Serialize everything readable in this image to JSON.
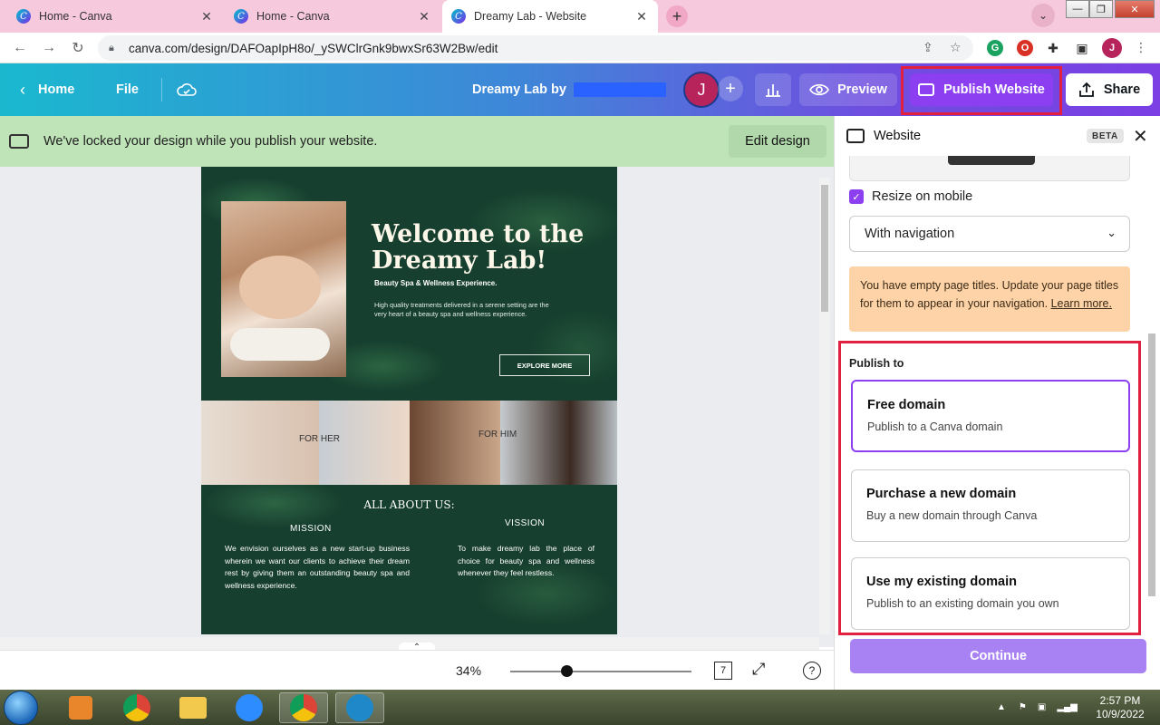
{
  "browser": {
    "tabs": [
      {
        "title": "Home - Canva",
        "active": false
      },
      {
        "title": "Home - Canva",
        "active": false
      },
      {
        "title": "Dreamy Lab - Website",
        "active": true
      }
    ],
    "url": "canva.com/design/DAFOapIpH8o/_ySWClrGnk9bwxSr63W2Bw/edit",
    "profile_initial": "J"
  },
  "topbar": {
    "home_label": "Home",
    "file_label": "File",
    "doc_title": "Dreamy Lab by",
    "avatar_initial": "J",
    "preview_label": "Preview",
    "publish_label": "Publish Website",
    "share_label": "Share"
  },
  "banner": {
    "message": "We've locked your design while you publish your website.",
    "edit_label": "Edit design"
  },
  "design": {
    "welcome": "Welcome to the Dreamy Lab!",
    "tagline": "Beauty Spa & Wellness Experience.",
    "intro": "High quality treatments delivered in a serene setting are the very heart of a beauty spa and wellness experience.",
    "cta": "EXPLORE MORE",
    "for_her": "FOR HER",
    "for_him": "FOR HIM",
    "about_title": "ALL ABOUT US:",
    "mission_heading": "MISSION",
    "mission_text": "We envision ourselves as a new start-up business wherein we want our clients to achieve their dream rest by giving them an outstanding beauty spa and wellness experience.",
    "vision_heading": "VISSION",
    "vision_text": "To make dreamy lab the place of choice for beauty spa and wellness whenever they feel restless."
  },
  "zoom": {
    "percent": "34%",
    "level": 0.34,
    "pages": "7"
  },
  "panel": {
    "title": "Website",
    "badge": "BETA",
    "resize_label": "Resize on mobile",
    "resize_checked": true,
    "nav_select": "With navigation",
    "warning_text": "You have empty page titles. Update your page titles for them to appear in your navigation.",
    "warning_link": "Learn more.",
    "publish_to_label": "Publish to",
    "options": [
      {
        "title": "Free domain",
        "desc": "Publish to a Canva domain",
        "selected": true
      },
      {
        "title": "Purchase a new domain",
        "desc": "Buy a new domain through Canva",
        "selected": false
      },
      {
        "title": "Use my existing domain",
        "desc": "Publish to an existing domain you own",
        "selected": false
      }
    ],
    "continue_label": "Continue"
  },
  "taskbar": {
    "time": "2:57 PM",
    "date": "10/9/2022"
  },
  "colors": {
    "accent_purple": "#8b3ff0",
    "highlight_red": "#e0203e",
    "banner_green": "#bfe4b8",
    "warning_orange": "#fdd3a7"
  }
}
